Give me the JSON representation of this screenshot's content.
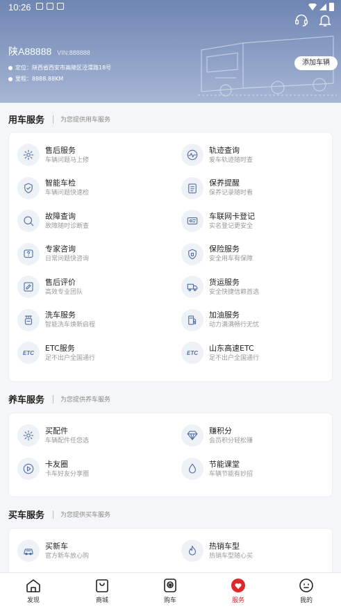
{
  "status_bar": {
    "time": "10:26"
  },
  "vehicle": {
    "plate": "陕A88888",
    "vin": "VIN:888888",
    "location": "定位：陕西省西安市高陵区泾渭路18号",
    "mileage": "里程：8888.88KM",
    "add_button": "添加车辆"
  },
  "sections": {
    "use": {
      "title": "用车服务",
      "subtitle": "为您提供用车服务"
    },
    "maintain": {
      "title": "养车服务",
      "subtitle": "为您提供养车服务"
    },
    "buy": {
      "title": "买车服务",
      "subtitle": "为您提供买车服务"
    }
  },
  "use_items": [
    {
      "name": "售后服务",
      "desc": "车辆问题马上修",
      "icon": "gear-icon"
    },
    {
      "name": "轨迹查询",
      "desc": "爱车轨迹随时查",
      "icon": "track-icon"
    },
    {
      "name": "智能车检",
      "desc": "车辆问题快速检",
      "icon": "shield-check-icon"
    },
    {
      "name": "保养提醒",
      "desc": "保养记录随时看",
      "icon": "calendar-icon"
    },
    {
      "name": "故障查询",
      "desc": "故障随时诊断查",
      "icon": "search-icon"
    },
    {
      "name": "车联网卡登记",
      "desc": "实名登记更安全",
      "icon": "id-card-icon"
    },
    {
      "name": "专家咨询",
      "desc": "日常问题快咨询",
      "icon": "question-icon"
    },
    {
      "name": "保险服务",
      "desc": "安全用车有保障",
      "icon": "insurance-icon"
    },
    {
      "name": "售后评价",
      "desc": "高效专业团队",
      "icon": "edit-icon"
    },
    {
      "name": "货运服务",
      "desc": "安全快捷信赖首选",
      "icon": "truck-icon"
    },
    {
      "name": "洗车服务",
      "desc": "智能洗车焕新启程",
      "icon": "car-wash-icon"
    },
    {
      "name": "加油服务",
      "desc": "动力满满畅行无忧",
      "icon": "fuel-icon"
    },
    {
      "name": "ETC服务",
      "desc": "足不出户全国通行",
      "icon": "etc-icon",
      "badge": "ETC"
    },
    {
      "name": "山东高速ETC",
      "desc": "足不出户全国通行",
      "icon": "etc-icon",
      "badge": "ETC"
    }
  ],
  "maintain_items": [
    {
      "name": "买配件",
      "desc": "车辆配件任您选",
      "icon": "gear-icon"
    },
    {
      "name": "赚积分",
      "desc": "会员积分轻松赚",
      "icon": "diamond-icon"
    },
    {
      "name": "卡友圈",
      "desc": "卡车好友分享圈",
      "icon": "play-circle-icon"
    },
    {
      "name": "节能课堂",
      "desc": "车辆节能有妙招",
      "icon": "drop-icon"
    }
  ],
  "buy_items": [
    {
      "name": "买新车",
      "desc": "官方新车放心购",
      "icon": "new-car-icon"
    },
    {
      "name": "热销车型",
      "desc": "热销车型随心买",
      "icon": "hot-icon"
    }
  ],
  "nav": [
    {
      "label": "发现",
      "icon": "home-icon"
    },
    {
      "label": "商城",
      "icon": "shopping-bag-icon"
    },
    {
      "label": "购车",
      "icon": "money-icon"
    },
    {
      "label": "服务",
      "icon": "heart-icon",
      "active": true
    },
    {
      "label": "我的",
      "icon": "face-icon"
    }
  ],
  "colors": {
    "accent": "#e0282c",
    "header": "#7d92bb",
    "icon_bg": "#eef1f6",
    "icon_stroke": "#4f6fa6"
  }
}
